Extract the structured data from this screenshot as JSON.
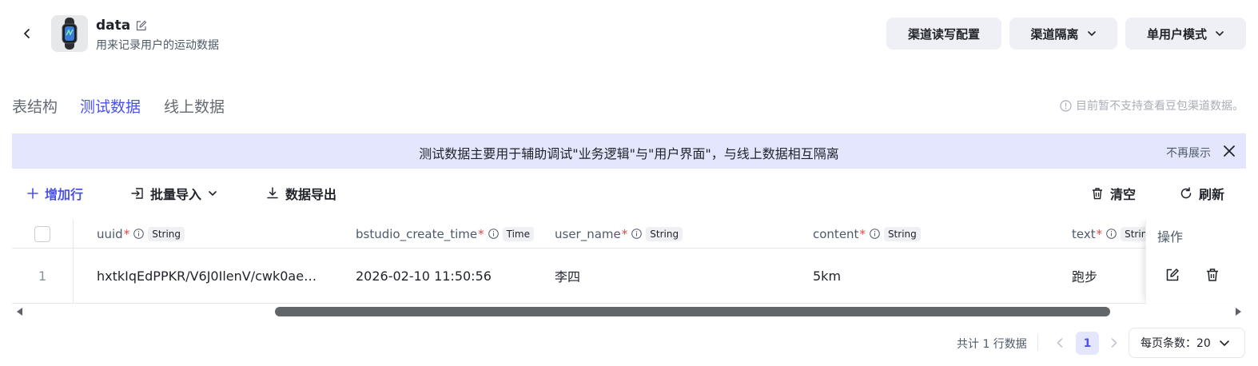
{
  "header": {
    "title": "data",
    "subtitle": "用来记录用户的运动数据",
    "buttons": {
      "channel_rw_config": "渠道读写配置",
      "channel_isolation": "渠道隔离",
      "single_user_mode": "单用户模式"
    }
  },
  "tabs": [
    {
      "label": "表结构",
      "active": false
    },
    {
      "label": "测试数据",
      "active": true
    },
    {
      "label": "线上数据",
      "active": false
    }
  ],
  "notice": "目前暂不支持查看豆包渠道数据。",
  "banner": {
    "text": "测试数据主要用于辅助调试\"业务逻辑\"与\"用户界面\"，与线上数据相互隔离",
    "dismiss": "不再展示"
  },
  "toolbar": {
    "add_row": "增加行",
    "batch_import": "批量导入",
    "export": "数据导出",
    "clear": "清空",
    "refresh": "刷新"
  },
  "table": {
    "columns": [
      {
        "name": "uuid",
        "required": "*",
        "type": "String"
      },
      {
        "name": "bstudio_create_time",
        "required": "*",
        "type": "Time"
      },
      {
        "name": "user_name",
        "required": "*",
        "type": "String"
      },
      {
        "name": "content",
        "required": "*",
        "type": "String"
      },
      {
        "name": "text",
        "required": "*",
        "type": "String"
      }
    ],
    "ops_header": "操作",
    "rows": [
      {
        "index": "1",
        "uuid": "hxtkIqEdPPKR/V6J0IlenV/cwk0ae…",
        "create_time": "2026-02-10 11:50:56",
        "user_name": "李四",
        "content": "5km",
        "text": "跑步"
      }
    ]
  },
  "pagination": {
    "total": "共计 1 行数据",
    "current_page": "1",
    "page_size": "每页条数：20"
  },
  "colors": {
    "accent": "#4a52e8",
    "banner_bg": "#e3e6fc",
    "button_bg": "#eef0f5",
    "required": "#f53f3f"
  }
}
